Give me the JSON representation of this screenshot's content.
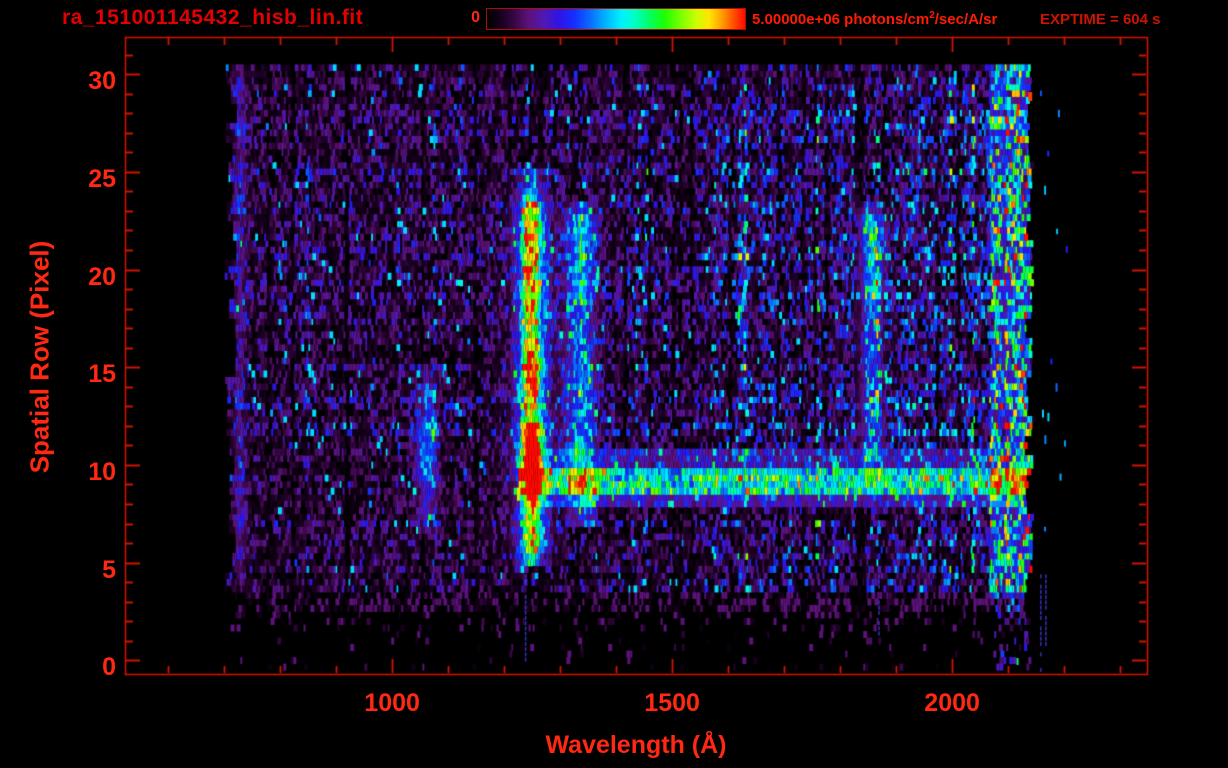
{
  "header": {
    "filename": "ra_151001145432_hisb_lin.fit",
    "exptime_label": "EXPTIME = 604 s",
    "colorbar": {
      "min_label": "0",
      "max_value": "5.00000e+06",
      "units_pre": " photons/cm",
      "units_sup": "2",
      "units_post": "/sec/A/sr"
    }
  },
  "theme": {
    "background": "#000000",
    "frame_color": "#d01400",
    "tick_label_color": "#ff2812",
    "title_color": "#e40000",
    "units_color": "#ff1c02",
    "exptime_color": "#cc1402"
  },
  "chart_data": {
    "type": "heatmap",
    "title": "ra_151001145432_hisb_lin.fit",
    "xlabel": "Wavelength (Å)",
    "ylabel": "Spatial Row (Pixel)",
    "xlim": [
      523,
      2348
    ],
    "ylim": [
      -0.7,
      31.9
    ],
    "x_major_ticks": [
      1000,
      1500,
      2000
    ],
    "x_minor_step": 100,
    "y_major_ticks": [
      0,
      5,
      10,
      15,
      20,
      25,
      30
    ],
    "y_minor_step": 1,
    "colorbar_scale": {
      "min": 0,
      "max": 5000000,
      "units": "photons/cm^2/sec/A/sr"
    },
    "exposure_seconds": 604,
    "data_extent": {
      "wavelength_range": [
        702,
        2143
      ],
      "row_range": [
        0,
        30.6
      ]
    },
    "colormap_stops": [
      [
        0.0,
        "#000000"
      ],
      [
        0.05,
        "#16001c"
      ],
      [
        0.1,
        "#330640"
      ],
      [
        0.16,
        "#5c1278"
      ],
      [
        0.22,
        "#5018b4"
      ],
      [
        0.28,
        "#2e14e6"
      ],
      [
        0.34,
        "#1430ff"
      ],
      [
        0.4,
        "#0a6cff"
      ],
      [
        0.46,
        "#00b4ff"
      ],
      [
        0.52,
        "#00f0ff"
      ],
      [
        0.57,
        "#00ffc8"
      ],
      [
        0.63,
        "#00ff64"
      ],
      [
        0.69,
        "#1eff00"
      ],
      [
        0.75,
        "#78ff00"
      ],
      [
        0.81,
        "#c8ff00"
      ],
      [
        0.86,
        "#ffe600"
      ],
      [
        0.91,
        "#ffa000"
      ],
      [
        0.955,
        "#ff5000"
      ],
      [
        1.0,
        "#ff0a00"
      ]
    ],
    "noise_regions": [
      {
        "from": 702,
        "to": 1250,
        "level": 0.115
      },
      {
        "from": 1250,
        "to": 1580,
        "level": 0.135
      },
      {
        "from": 1580,
        "to": 1900,
        "level": 0.175
      },
      {
        "from": 1900,
        "to": 2068,
        "level": 0.205
      },
      {
        "from": 2068,
        "to": 2143,
        "level": 0.3
      }
    ],
    "row_density": {
      "0": 0.05,
      "1": 0.07,
      "2": 0.18,
      "3": 0.55,
      "4": 0.9,
      "default": 1.0
    },
    "features": [
      {
        "name": "emission-band-lya",
        "type": "vertical-band",
        "center": 1250,
        "sigma": 13,
        "halo_sigma": 26,
        "halo_amplitude": 0.2,
        "rows": [
          4.7,
          24.2
        ],
        "amplitude": 0.56,
        "hot_rows": [
          [
            9.3,
            12.0,
            0.82
          ],
          [
            13.5,
            16.0,
            0.68
          ],
          [
            19.0,
            23.0,
            0.62
          ]
        ],
        "tip_row": 25.3
      },
      {
        "name": "emission-band-1337",
        "type": "vertical-band",
        "center": 1337,
        "sigma": 17,
        "rows": [
          7.0,
          23.6
        ],
        "amplitude": 0.33,
        "hot_rows": [
          [
            18.0,
            23.6,
            0.41
          ],
          [
            8.8,
            11.2,
            0.4
          ]
        ]
      },
      {
        "name": "emission-band-1062",
        "type": "vertical-band",
        "center": 1062,
        "sigma": 13,
        "rows": [
          6.5,
          15.0
        ],
        "amplitude": 0.2,
        "hot_rows": [
          [
            9.0,
            12.0,
            0.35
          ]
        ]
      },
      {
        "name": "emission-band-1857",
        "type": "vertical-band",
        "center": 1857,
        "sigma": 15,
        "rows": [
          9.5,
          23.6
        ],
        "amplitude": 0.27,
        "hot_rows": [
          [
            18.5,
            23.6,
            0.37
          ]
        ]
      },
      {
        "name": "left-edge-column",
        "type": "vertical-band",
        "center": 728,
        "sigma": 9,
        "rows": [
          4.0,
          30.6
        ],
        "amplitude": 0.12
      },
      {
        "name": "stellar-continuum",
        "type": "horizontal-stripe",
        "rows": [
          8.4,
          9.8
        ],
        "halo_rows": [
          7.7,
          10.7
        ],
        "range": [
          1225,
          2143
        ],
        "amplitude": 0.44,
        "halo_amplitude": 0.15
      },
      {
        "name": "right-edge-airglow",
        "type": "vertical-zone",
        "range": [
          2068,
          2143
        ],
        "amplitude": 0.2,
        "speckle_from": 2118,
        "speckle_value": 0.92
      }
    ],
    "faint_lines_below": [
      {
        "wavelength": 1237,
        "to_row": -0.6
      },
      {
        "wavelength": 1868,
        "to_row": 1.4
      },
      {
        "wavelength": 2157,
        "to_row": -0.6
      },
      {
        "wavelength": 2166,
        "to_row": 0.4
      }
    ]
  }
}
